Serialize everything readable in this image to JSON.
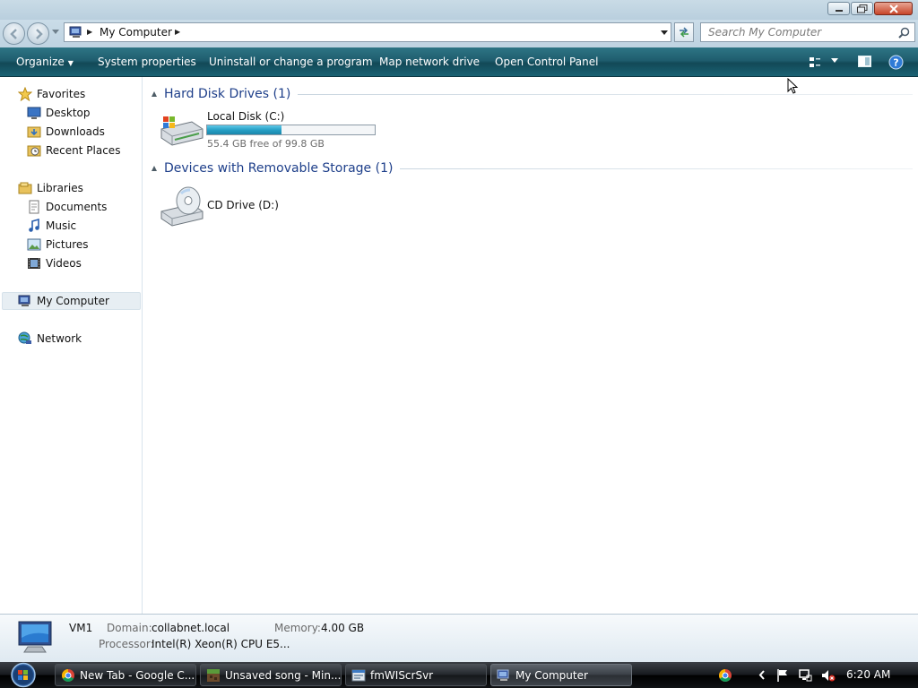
{
  "window": {
    "title": "My Computer"
  },
  "address": {
    "breadcrumb": "My Computer",
    "search_placeholder": "Search My Computer"
  },
  "toolbar": {
    "organize": "Organize",
    "system_properties": "System properties",
    "uninstall": "Uninstall or change a program",
    "map_drive": "Map network drive",
    "control_panel": "Open Control Panel"
  },
  "sidebar": {
    "favorites": "Favorites",
    "desktop": "Desktop",
    "downloads": "Downloads",
    "recent_places": "Recent Places",
    "libraries": "Libraries",
    "documents": "Documents",
    "music": "Music",
    "pictures": "Pictures",
    "videos": "Videos",
    "my_computer": "My Computer",
    "network": "Network"
  },
  "content": {
    "hard_disk_group": "Hard Disk Drives (1)",
    "local_disk": {
      "name": "Local Disk (C:)",
      "free_text": "55.4 GB free of 99.8 GB",
      "used_fraction": 0.445
    },
    "removable_group": "Devices with Removable Storage (1)",
    "cd_drive": {
      "name": "CD Drive (D:)"
    }
  },
  "details": {
    "computer_name": "VM1",
    "domain_label": "Domain:",
    "domain_value": "collabnet.local",
    "memory_label": "Memory:",
    "memory_value": "4.00 GB",
    "processor_label": "Processor:",
    "processor_value": "Intel(R) Xeon(R) CPU E5..."
  },
  "taskbar": {
    "items": [
      {
        "label": "New Tab - Google C...",
        "icon": "chrome-icon"
      },
      {
        "label": "Unsaved song - Min...",
        "icon": "minecraft-icon"
      },
      {
        "label": "fmWIScrSvr",
        "icon": "app-window-icon"
      },
      {
        "label": "My Computer",
        "icon": "computer-icon"
      }
    ],
    "clock": "6:20 AM"
  },
  "colors": {
    "command_bar": "#1f5d6e",
    "group_header_text": "#1e3f8a",
    "capacity_fill": "#26a0c6"
  }
}
